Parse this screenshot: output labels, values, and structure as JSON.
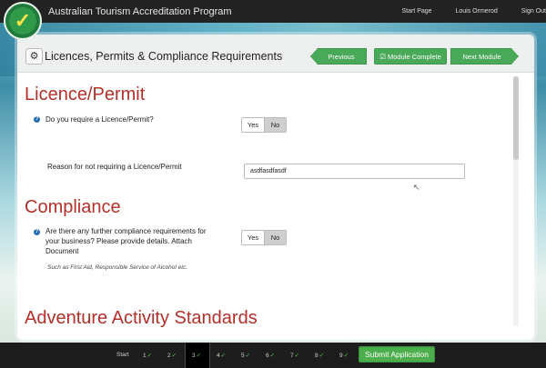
{
  "app": {
    "title": "Australian Tourism Accreditation Program",
    "logo_icon": "tick-seal-icon"
  },
  "top_links": [
    "Start Page",
    "Louis Ormerod",
    "Sign Out"
  ],
  "module": {
    "title": "Licences, Permits & Compliance Requirements",
    "prev_label": "Previous Module",
    "complete_label": "Module Complete",
    "next_label": "Next Module"
  },
  "sections": {
    "licence_title": "Licence/Permit",
    "licence_question": "Do you require a Licence/Permit?",
    "licence_reason_label": "Reason for not requiring a Licence/Permit",
    "licence_reason_value": "asdfasdfasdf",
    "compliance_title": "Compliance",
    "compliance_question": "Are there any further compliance requirements for your business? Please provide details. Attach Document",
    "compliance_hint": "Such as First Aid, Responsible Service of Alcohol etc.",
    "adventure_title": "Adventure Activity Standards"
  },
  "yes_label": "Yes",
  "no_label": "No",
  "steps": {
    "start": "Start",
    "items": [
      "1",
      "2",
      "3",
      "4",
      "5",
      "6",
      "7",
      "8",
      "9"
    ],
    "tick": "✓",
    "current": "3"
  },
  "submit_label": "Submit Application",
  "colors": {
    "accent_green": "#4aa958",
    "section_red": "#b2302a",
    "topbar": "#222222"
  }
}
